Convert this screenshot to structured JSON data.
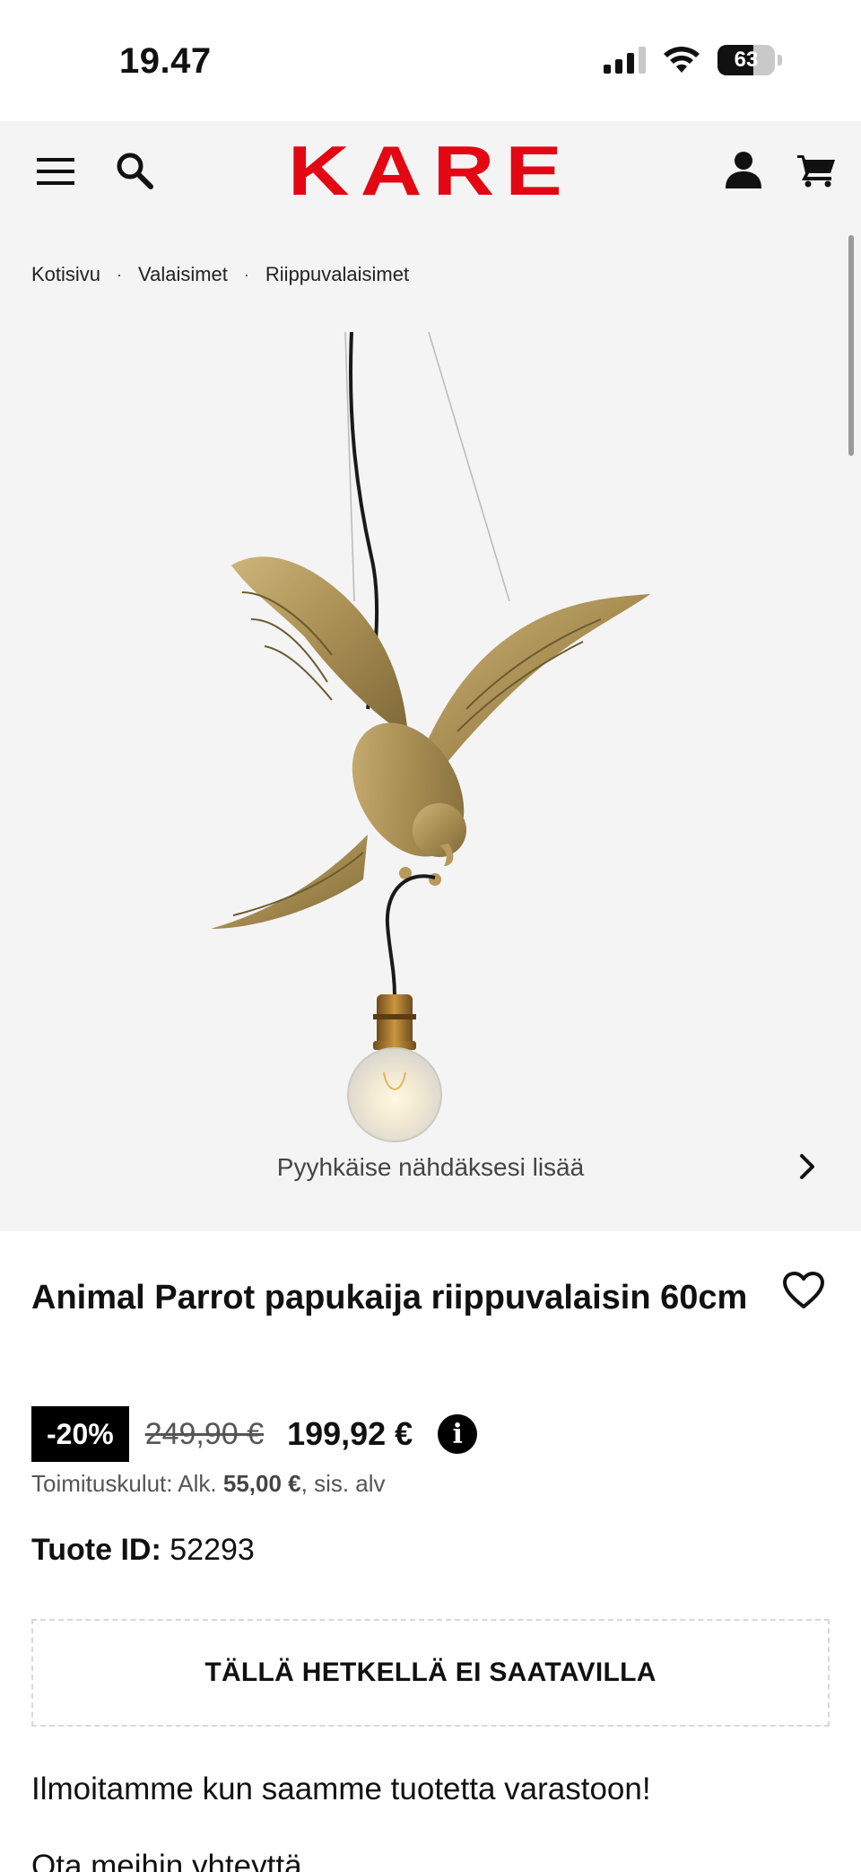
{
  "status_bar": {
    "time": "19.47",
    "battery_level": 0.63,
    "battery_text": "63"
  },
  "header": {
    "logo_text": "KARE",
    "brand_color": "#e30613",
    "icons": [
      "menu-icon",
      "search-icon",
      "account-icon",
      "cart-icon"
    ]
  },
  "breadcrumb": {
    "items": [
      "Kotisivu",
      "Valaisimet",
      "Riippuvalaisimet"
    ],
    "separator": "·"
  },
  "gallery": {
    "swipe_hint": "Pyyhkäise nähdäksesi lisää"
  },
  "product": {
    "title": "Animal Parrot papukaija riippuvalaisin 60cm",
    "discount": "-20%",
    "old_price": "249,90 €",
    "new_price": "199,92 €",
    "info_symbol": "i",
    "shipping_prefix": "Toimituskulut: Alk.",
    "shipping_amount": "55,00 €",
    "shipping_suffix": ", sis. alv",
    "id_label": "Tuote ID:",
    "id_value": "52293",
    "availability": "TÄLLÄ HETKELLÄ EI SAATAVILLA",
    "notify_text": "Ilmoitamme kun saamme tuotetta varastoon!",
    "contact_text": "Ota meihin yhteyttä"
  }
}
